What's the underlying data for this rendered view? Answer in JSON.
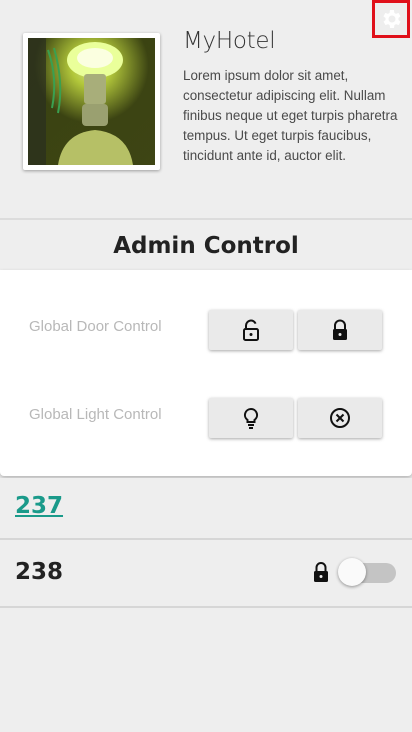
{
  "header": {
    "hotel_name": "MyHotel",
    "description": "Lorem ipsum dolor sit amet, consectetur adipiscing elit. Nullam finibus neque ut eget turpis pharetra tempus. Ut eget turpis faucibus, tincidunt ante id, auctor elit."
  },
  "admin": {
    "title": "Admin Control",
    "door_label": "Global Door Control",
    "light_label": "Global Light Control"
  },
  "rooms": [
    {
      "number": "237",
      "is_link": true
    },
    {
      "number": "238",
      "locked": true,
      "light_on": false
    }
  ],
  "icons": {
    "settings": "gear-icon",
    "door_unlock": "lock-open-icon",
    "door_lock": "lock-icon",
    "light_on": "lightbulb-icon",
    "light_off": "cancel-circle-icon"
  },
  "colors": {
    "accent": "#1a9a8a",
    "highlight": "#e0101a"
  }
}
